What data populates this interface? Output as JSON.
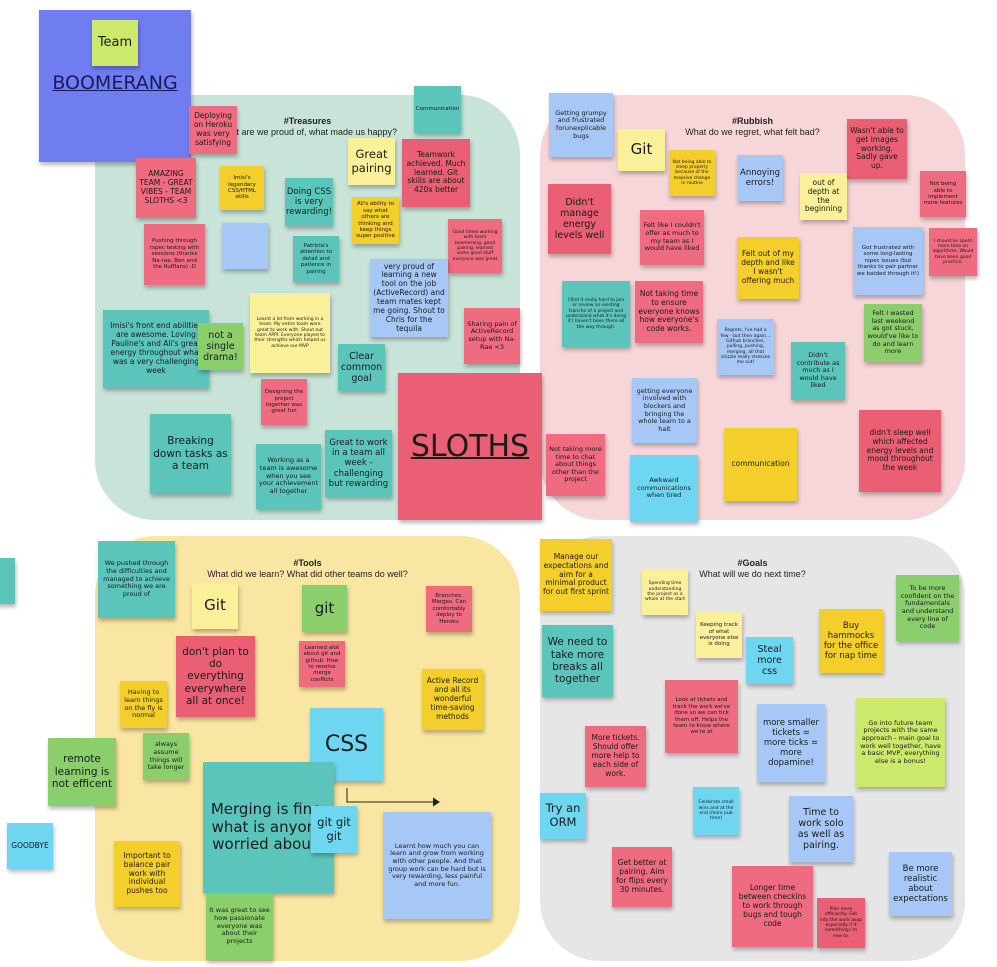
{
  "board": {
    "team_note": "Team",
    "team_name": "BOOMERANG",
    "center_note": "SLOTHS",
    "goodbye": "GOODBYE",
    "remote": "remote learning is not efficent"
  },
  "zones": {
    "treasures": {
      "title": "#Treasures",
      "subtitle": "What are we proud of, what made us happy?",
      "color": "#c8e3d8",
      "notes": [
        "Deploying on Heroku was very satisfying",
        "AMAZING TEAM - GREAT VIBES - TEAM SLOTHS <3",
        "Imisi's legendary CSS/HTML skills",
        "Doing CSS is very rewarding!",
        "Great pairing",
        "Ali's ability to say what others are thinking and keep things super positive",
        "Teamwork achieved. Much learned. Git skills are about 420x better",
        "Communication",
        "Pushing through rspec testing with sessions (thanks Na-rae, Ben and the Rufflans) :D",
        "",
        "Patricia's attention to detail and patience in pairing",
        "Good times working with team boomerang, good pairing, learned some good stuff everyone was great",
        "very proud of learning a new tool on the job (ActiveRecord) and team mates kept me going. Shout to Chris for the tequila",
        "Learnt a lot from working in a team. My entire team were great to work with. Shout out team APPI. Everyone played to their strengths which helped us achieve our MVP",
        "Imisi's front end abilities are awesome. Loving Pauline's and Ali's great energy throughout what was a very challenging week",
        "not a single drama!",
        "Clear common goal",
        "Sharing pain of ActiveRecord setup with Na-Rae <3",
        "Designing the project together was great fun",
        "Breaking down tasks as a team",
        "Working as a team is awesome when you see your achievement all together",
        "Great to work in a team all week - challenging but rewarding"
      ]
    },
    "rubbish": {
      "title": "#Rubbish",
      "subtitle": "What do we regret, what felt bad?",
      "color": "#f6d6d8",
      "notes": [
        "Getting grumpy and frustrated forunexplicable bugs",
        "Git",
        "Not being able to sleep properly because of the massive change in routine",
        "Annoying errors!",
        "Wasn't able to get images working. Sadly gave up.",
        "Not being able to implement more features",
        "out of depth at the beginning",
        "Didn't manage energy levels well",
        "Felt like I couldn't offer as much to my team as I would have liked",
        "Felt out of my depth and like I wasn't offering much",
        "Got frustrated with some long-lasting rspec issues (but thanks to pair partner we batded through it!)",
        "I should've spent more time on algorithms. Would have been good practice.",
        "I find it really hard to join or review an existing tranche of a project and understand what it's doing if I haven't been there all the way through.",
        "Not taking time to ensure everyone knows how everyone's code works.",
        "Regrets, I've had a few - but then again... Github branches, pulling, pushing, merging, all that shizzle really stresses me out!",
        "Didn't contribute as much as I would have liked",
        "Felt I wasted last weekend as got stuck, would've like to do and learn more",
        "getting everyone involved with blockers and bringing the whole team to a halt",
        "Not taking more time to chat about things other than the project",
        "communication",
        "Awkward communications when tired",
        "didn't sleep well which affected energy levels and mood throughout the week"
      ]
    },
    "tools": {
      "title": "#Tools",
      "subtitle": "What did we learn? What did other teams do well?",
      "color": "#fae6a3",
      "notes": [
        "We pushed through the difficulties and managed to achieve something we are proud of",
        "Git",
        "git",
        "Branches. Merges. Can comfortably deploy to Heroku",
        "don't plan to do everything everywhere all at once!",
        "Learned alot about git and github. How to resolve merge conflicts",
        "Active Record and all its wonderful time-saving methods",
        "Having to learn things on the fly is normal",
        "always assume things will take longer",
        "CSS",
        "Merging is fine, what is anyone worried about?",
        "git git git",
        "Learnt how much you can learn and grow from working with other people. And that group work can be hard but is very rewarding, less painful and more fun.",
        "Important to balance pair work with individual pushes too",
        "It was great to see how passionate everyone was about their projects"
      ]
    },
    "goals": {
      "title": "#Goals",
      "subtitle": "What will we do next time?",
      "color": "#e6e6e6",
      "notes": [
        "Manage our expectations and aim for a minimal product for out first sprint",
        "Spending time understanding the project as a whole at the start",
        "To be more confident on the fundamentals and understand every line of code",
        "We need to take more breaks all together",
        "Keeping track of what everyone else is doing",
        "Steal more css",
        "Buy hammocks for the office for nap time",
        "Look at tickets and track the work we've done so we can tick them off. Helps the team to know where we're at",
        "Go into future team projects with the same approach - main goal to work well together, have a basic MVP, everything else is a bonus!",
        "More tickets. Should offer more help to each side of work.",
        "more smaller tickets = more ticks = more dopamine!",
        "Try an ORM",
        "Celebrate small wins and at the end (more pub time)",
        "Time to work solo as well as pairing.",
        "Get better at pairing. Aim for flips every 30 minutes.",
        "Longer time between checkins to work through bugs and tough code",
        "Plan more efficiently. Get into the work asap especially if it something I'm new to.",
        "Be more realistic about expectations"
      ]
    }
  }
}
